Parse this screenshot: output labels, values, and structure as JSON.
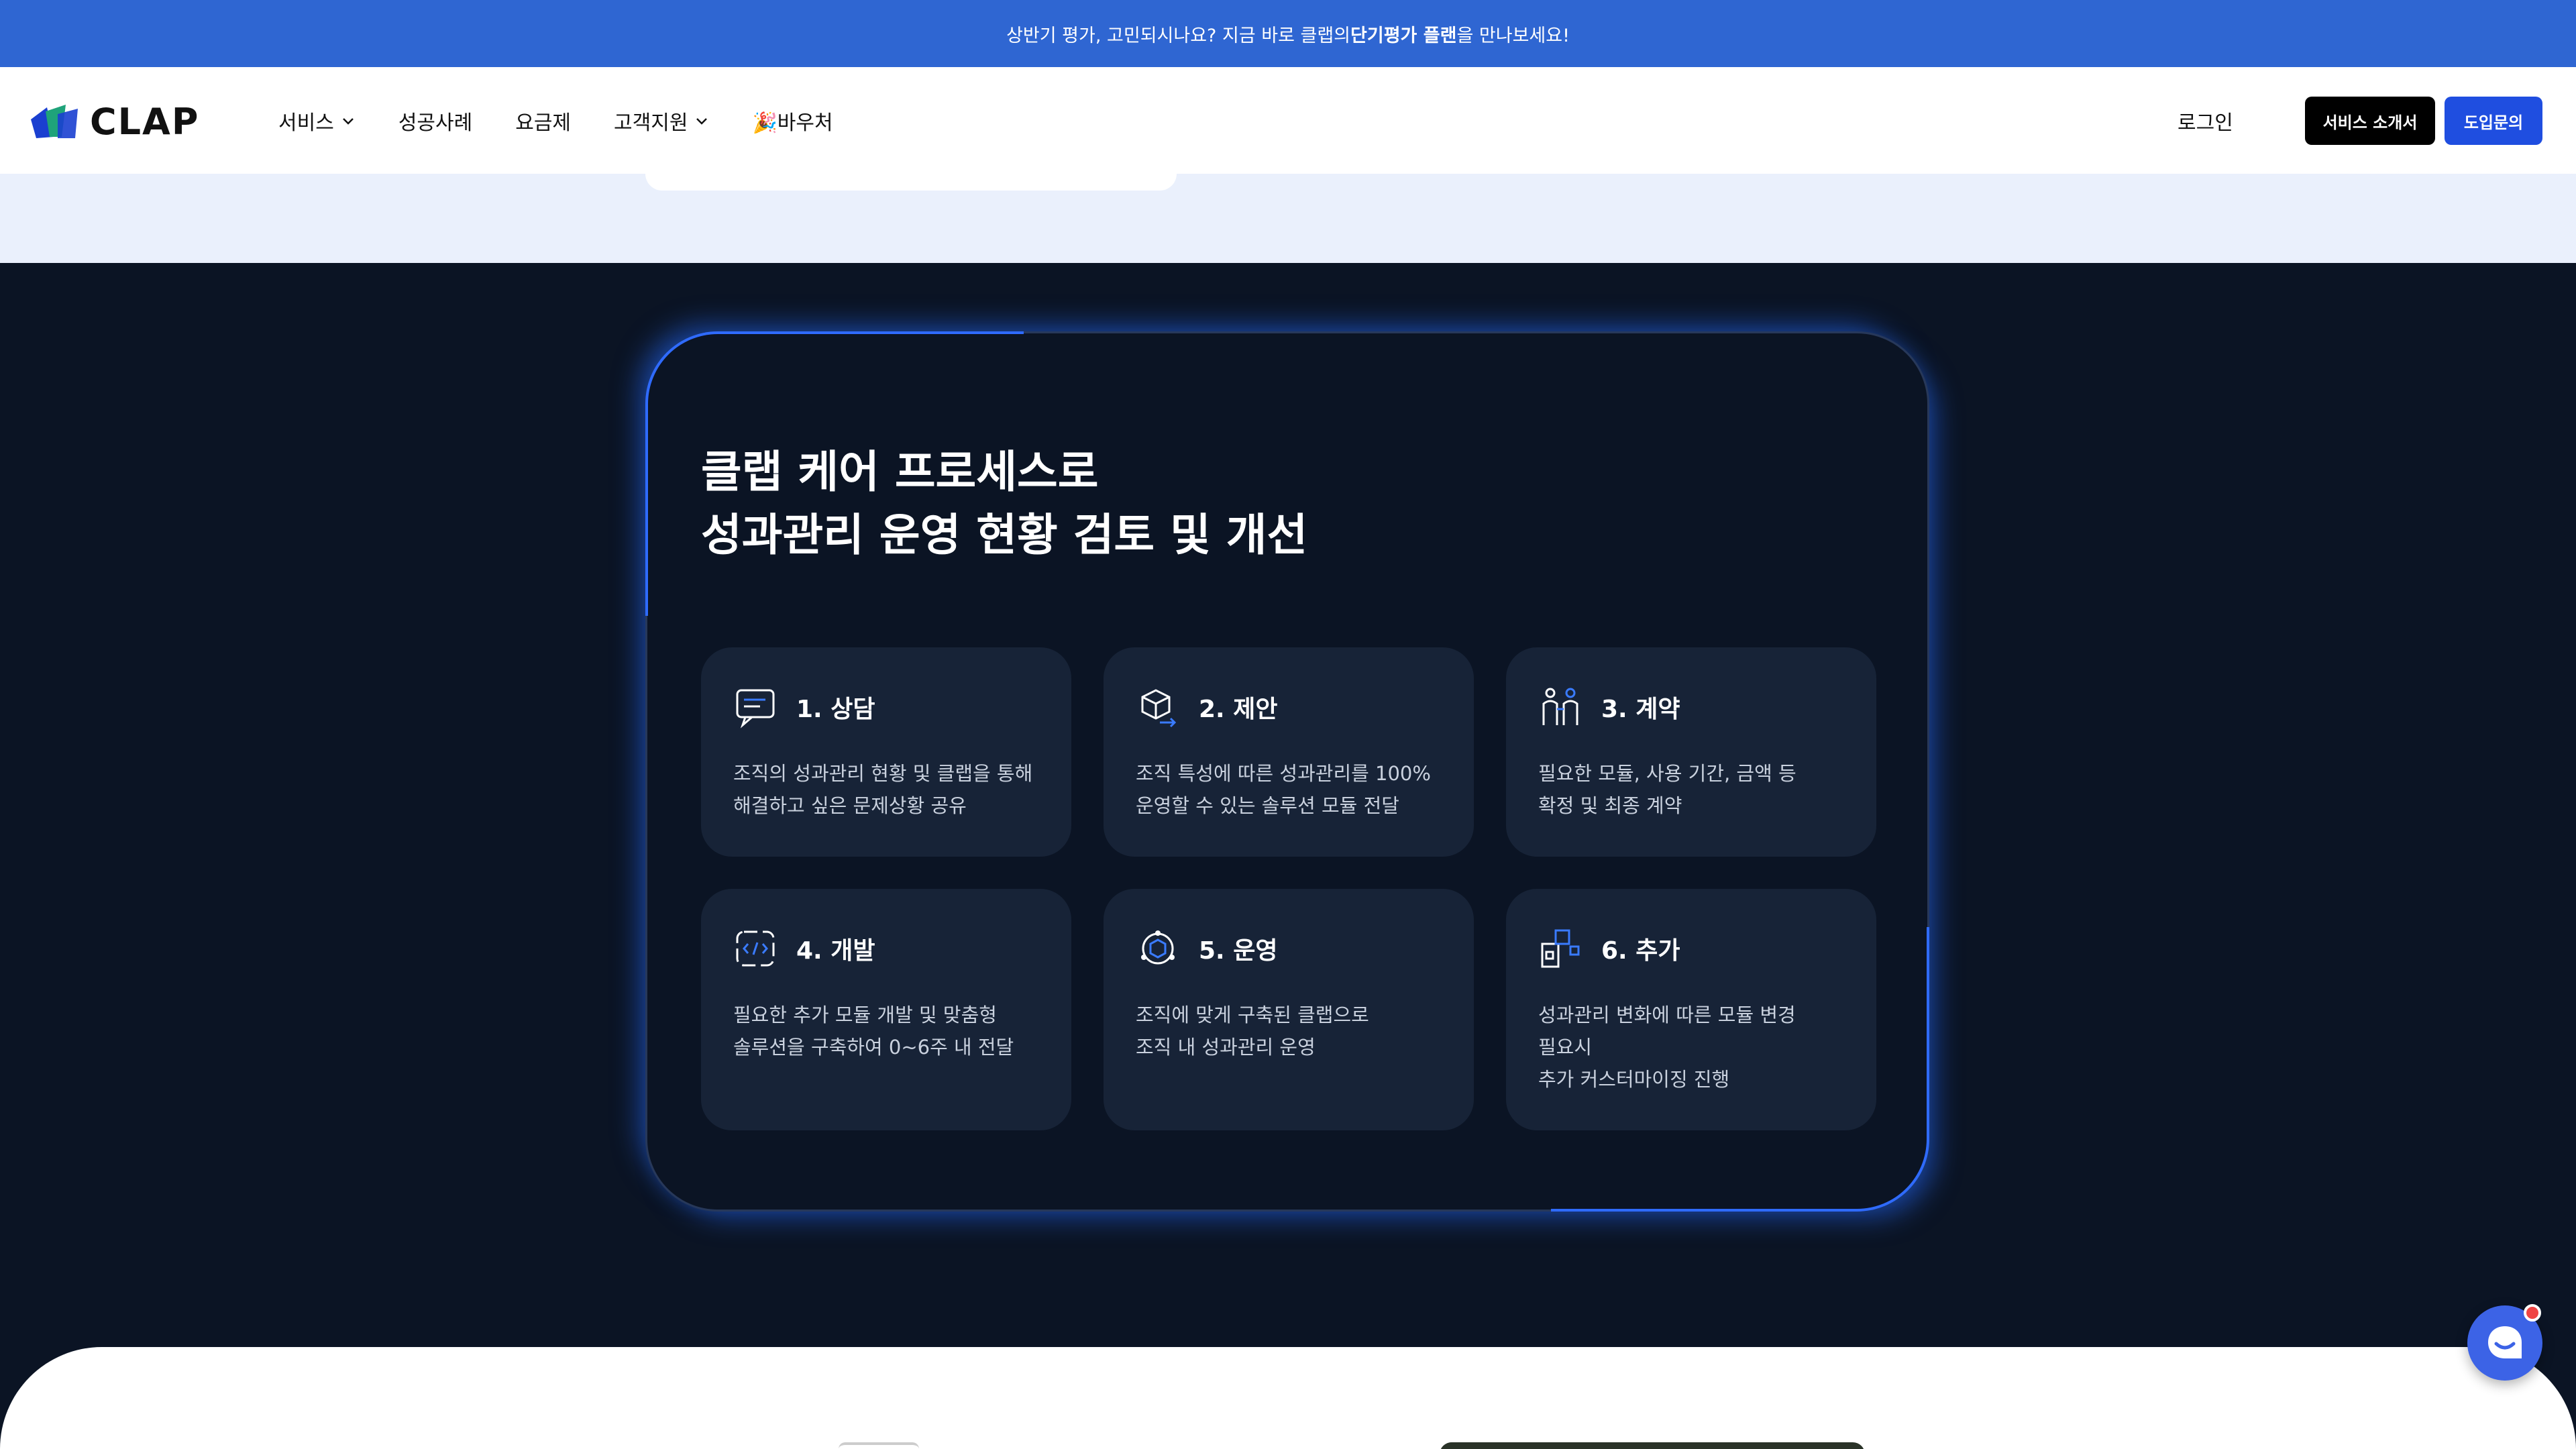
{
  "banner": {
    "text_before": "상반기 평가, 고민되시나요? 지금 바로 클랩의 ",
    "text_bold": "단기평가 플랜",
    "text_after": "을 만나보세요!"
  },
  "header": {
    "logo_text": "CLAP",
    "nav": [
      {
        "label": "서비스",
        "has_dropdown": true
      },
      {
        "label": "성공사례",
        "has_dropdown": false
      },
      {
        "label": "요금제",
        "has_dropdown": false
      },
      {
        "label": "고객지원",
        "has_dropdown": true
      },
      {
        "label": "🎉바우처",
        "has_dropdown": false
      }
    ],
    "login_label": "로그인",
    "intro_button": "서비스 소개서",
    "inquiry_button": "도입문의"
  },
  "care": {
    "title_line1": "클랩 케어 프로세스로",
    "title_line2": "성과관리 운영 현황 검토 및 개선",
    "steps": [
      {
        "label": "1. 상담",
        "icon": "chat-icon",
        "desc": "조직의 성과관리 현황 및 클랩을 통해\n해결하고 싶은 문제상황 공유"
      },
      {
        "label": "2. 제안",
        "icon": "box-arrow-icon",
        "desc": "조직 특성에 따른 성과관리를 100%\n운영할 수 있는 솔루션 모듈 전달"
      },
      {
        "label": "3. 계약",
        "icon": "people-icon",
        "desc": "필요한 모듈, 사용 기간, 금액 등\n확정 및 최종 계약"
      },
      {
        "label": "4. 개발",
        "icon": "code-icon",
        "desc": "필요한 추가 모듈 개발 및 맞춤형\n솔루션을 구축하여 0~6주 내 전달"
      },
      {
        "label": "5. 운영",
        "icon": "hexagon-icon",
        "desc": "조직에 맞게 구축된 클랩으로\n조직 내 성과관리 운영"
      },
      {
        "label": "6. 추가",
        "icon": "modules-icon",
        "desc": "성과관리 변화에 따른 모듈 변경\n필요시\n추가 커스터마이징 진행"
      }
    ]
  },
  "colors": {
    "banner_bg": "#2f66d2",
    "dark_bg": "#0b1424",
    "card_bg": "#172337",
    "accent": "#1f4ee0",
    "glow": "#2f6bff"
  }
}
